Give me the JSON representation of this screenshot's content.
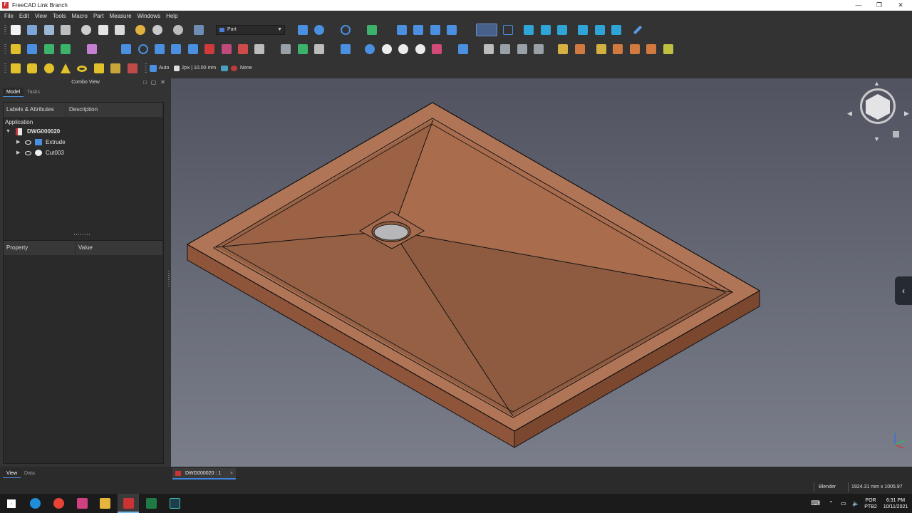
{
  "window": {
    "title": "FreeCAD Link Branch",
    "icon": "freecad-logo-icon"
  },
  "menu": [
    "File",
    "Edit",
    "View",
    "Tools",
    "Macro",
    "Part",
    "Measure",
    "Windows",
    "Help"
  ],
  "toolbar": {
    "workbench": "Part",
    "draw_style": "Auto",
    "line_width": "2px | 10.00 mm",
    "material": "None"
  },
  "combo_view": {
    "title": "Combo View",
    "tabs": [
      "Model",
      "Tasks"
    ],
    "tree_headers": [
      "Labels & Attributes",
      "Description"
    ],
    "tree_root_label": "Application",
    "document": "DWG000020",
    "items": [
      {
        "label": "Extrude",
        "icon": "extrude-icon"
      },
      {
        "label": "Cut003",
        "icon": "cut-icon"
      }
    ],
    "property_headers": [
      "Property",
      "Value"
    ],
    "bottom_tabs": [
      "View",
      "Data"
    ]
  },
  "document_tab": "DWG000020 : 1",
  "status": {
    "navigation": "Blender",
    "dimensions": "1924.31 mm x 1005.97 mm"
  },
  "taskbar": {
    "language_top": "POR",
    "language_bottom": "PTB2",
    "time": "6:31 PM",
    "date": "10/11/2021"
  },
  "colors": {
    "model_top": "#b07152",
    "model_side": "#8a5238",
    "background_top": "#515360",
    "background_bottom": "#7a7d8a",
    "accent": "#3d85e0"
  }
}
